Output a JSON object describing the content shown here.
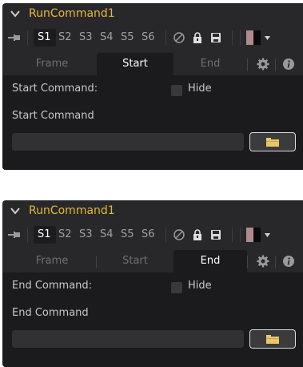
{
  "panels": [
    {
      "id": "start",
      "title": "RunCommand1",
      "slots": [
        "S1",
        "S2",
        "S3",
        "S4",
        "S5",
        "S6"
      ],
      "active_slot": "S1",
      "tabs": [
        "Frame",
        "Start",
        "End"
      ],
      "active_tab": "Start",
      "command_label": "Start Command:",
      "hide_label": "Hide",
      "hide_checked": false,
      "field_label": "Start Command",
      "field_value": ""
    },
    {
      "id": "end",
      "title": "RunCommand1",
      "slots": [
        "S1",
        "S2",
        "S3",
        "S4",
        "S5",
        "S6"
      ],
      "active_slot": "S1",
      "tabs": [
        "Frame",
        "Start",
        "End"
      ],
      "active_tab": "End",
      "command_label": "End Command:",
      "hide_label": "Hide",
      "hide_checked": false,
      "field_label": "End Command",
      "field_value": ""
    }
  ],
  "icons": {
    "collapse": "chevron-down-icon",
    "pin": "pin-icon",
    "pass_through": "pass-through-icon",
    "lock": "lock-icon",
    "save": "save-icon",
    "color": "color-swatch-icon",
    "dropdown": "caret-down-icon",
    "settings": "gear-icon",
    "info": "info-icon",
    "browse": "folder-icon"
  },
  "colors": {
    "title": "#e5b73b",
    "panel_bg": "#28282a",
    "content_bg": "#1b1b1d",
    "swatch_left": "#b08a8f",
    "swatch_right": "#0a0a0a",
    "folder": "#e8c66a"
  }
}
